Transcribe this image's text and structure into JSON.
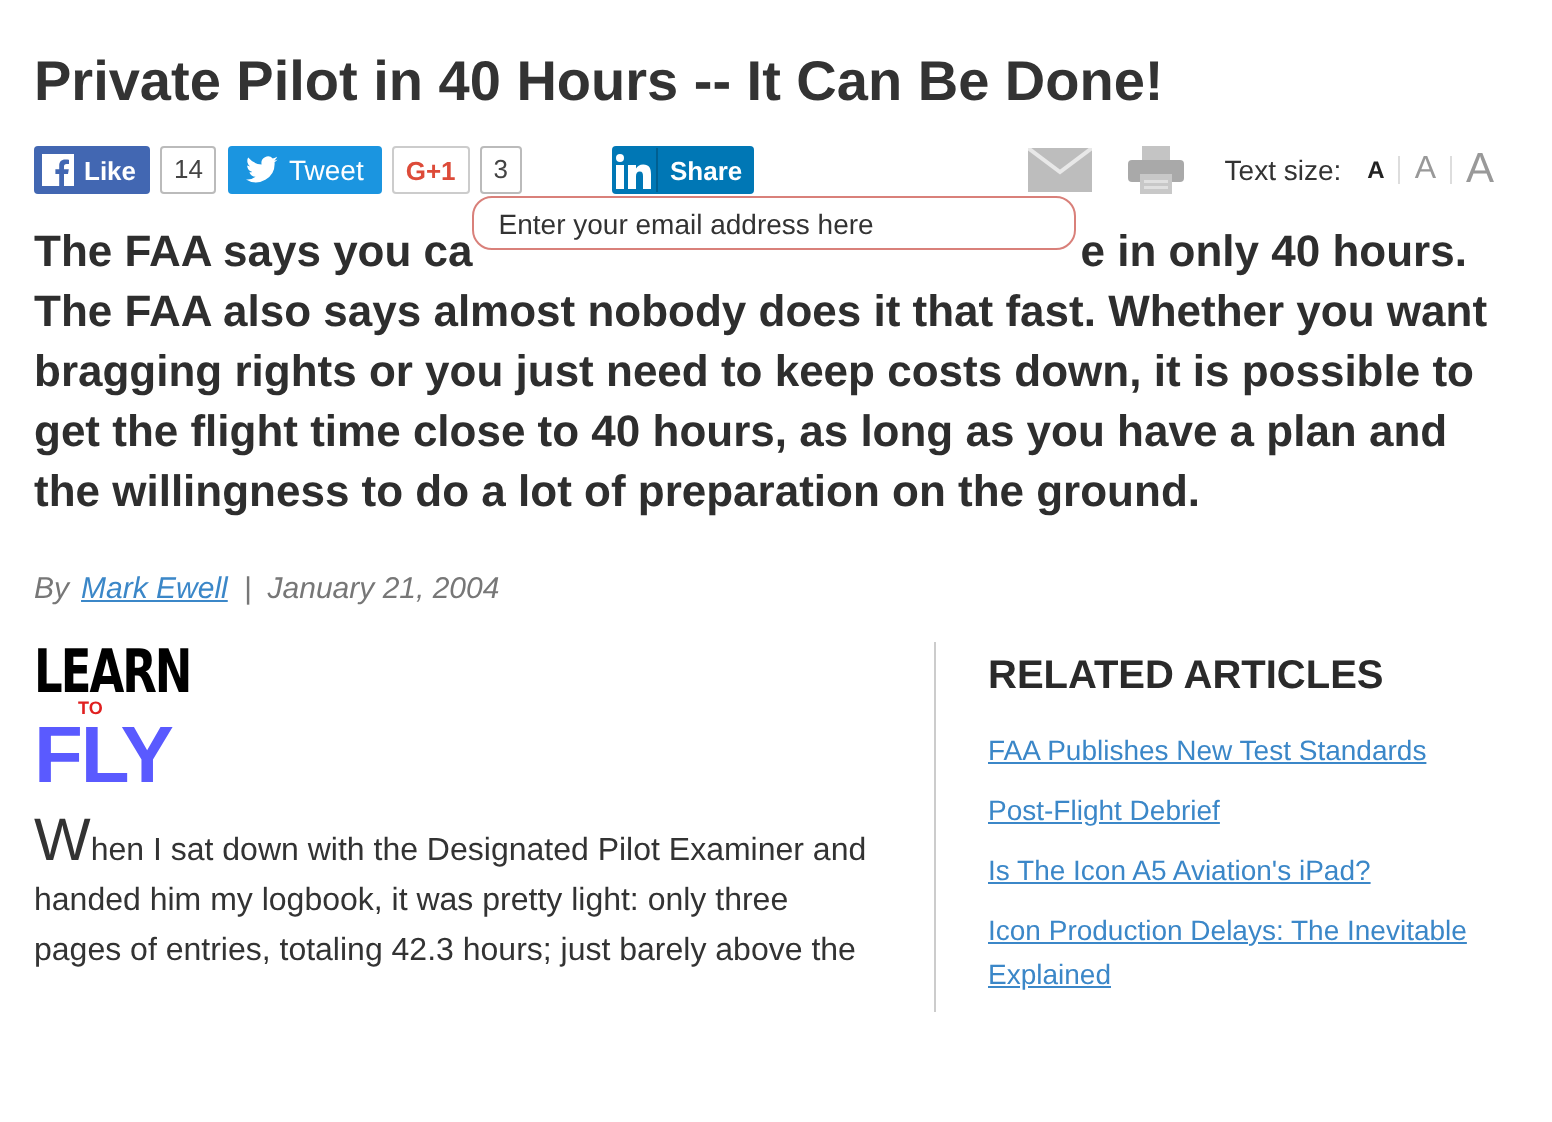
{
  "title": "Private Pilot in 40 Hours -- It Can Be Done!",
  "share": [
    {
      "kind": "facebook",
      "label": "Like",
      "count": "14"
    },
    {
      "kind": "twitter",
      "label": "Tweet"
    },
    {
      "kind": "gplus",
      "label": "G+1",
      "count": "3"
    },
    {
      "kind": "linkedin",
      "label": "Share"
    }
  ],
  "text_size": {
    "label": "Text size:",
    "options": [
      {
        "label": "A",
        "selected": true
      },
      {
        "label": "A",
        "selected": false
      },
      {
        "label": "A",
        "selected": false
      }
    ]
  },
  "email_field": {
    "placeholder": "Enter your email address here"
  },
  "intro": {
    "before_field": "The FAA says you ca",
    "after_field": "e in only 40 hours.",
    "rest": "The FAA also says almost nobody does it that fast. Whether you want bragging rights or you just need to keep costs down, it is possible to get the flight time close to 40 hours, as long as you have a plan and the willingness to do a lot of preparation on the ground."
  },
  "byline": {
    "by": "By",
    "author": "Mark Ewell",
    "separator": "|",
    "date": "January 21, 2004"
  },
  "logo": {
    "top": "LEARN",
    "middle": "TO",
    "bottom": "FLY"
  },
  "body": {
    "drop_cap": "W",
    "text": "hen I sat down with the Designated Pilot Examiner and handed him my logbook, it was pretty light: only three pages of entries, totaling 42.3 hours; just barely above the"
  },
  "related": {
    "heading": "RELATED ARTICLES",
    "links": [
      "FAA Publishes New Test Standards",
      "Post-Flight Debrief",
      "Is The Icon A5 Aviation's iPad?",
      "Icon Production Delays: The Inevitable Explained"
    ]
  }
}
